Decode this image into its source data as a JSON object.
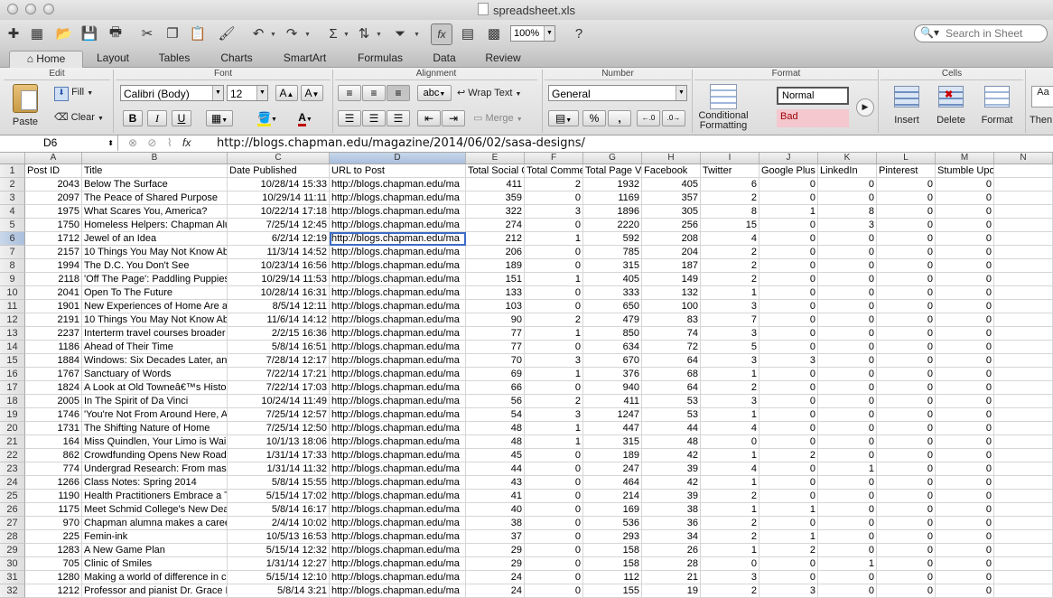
{
  "window": {
    "title": "spreadsheet.xls"
  },
  "toolbar": {
    "zoom": "100%",
    "search_placeholder": "Search in Sheet"
  },
  "ribbon_tabs": [
    {
      "label": "Home"
    },
    {
      "label": "Layout"
    },
    {
      "label": "Tables"
    },
    {
      "label": "Charts"
    },
    {
      "label": "SmartArt"
    },
    {
      "label": "Formulas"
    },
    {
      "label": "Data"
    },
    {
      "label": "Review"
    }
  ],
  "ribbon": {
    "edit_title": "Edit",
    "font_title": "Font",
    "alignment_title": "Alignment",
    "number_title": "Number",
    "format_title": "Format",
    "cells_title": "Cells",
    "paste": "Paste",
    "fill": "Fill",
    "clear": "Clear",
    "font_name": "Calibri (Body)",
    "font_size": "12",
    "bold": "B",
    "italic": "I",
    "underline": "U",
    "wrap_text": "Wrap Text",
    "merge": "Merge",
    "abc": "abc",
    "number_format": "General",
    "percent": "%",
    "comma": ",",
    "conditional_formatting_1": "Conditional",
    "conditional_formatting_2": "Formatting",
    "style_normal": "Normal",
    "style_bad": "Bad",
    "insert": "Insert",
    "delete": "Delete",
    "format": "Format",
    "themes": "Then"
  },
  "formula_bar": {
    "cell_ref": "D6",
    "fx": "fx",
    "content": "http://blogs.chapman.edu/magazine/2014/06/02/sasa-designs/"
  },
  "sheet": {
    "columns": [
      "A",
      "B",
      "C",
      "D",
      "E",
      "F",
      "G",
      "H",
      "I",
      "J",
      "K",
      "L",
      "M",
      "N"
    ],
    "headers": [
      "Post ID",
      "Title",
      "Date Published",
      "URL to Post",
      "Total Social C",
      "Total Comme",
      "Total Page Vi",
      "Facebook",
      "Twitter",
      "Google Plus",
      "LinkedIn",
      "Pinterest",
      "Stumble Upon",
      ""
    ],
    "row_numbers": [
      "1",
      "2",
      "3",
      "4",
      "5",
      "6",
      "7",
      "8",
      "9",
      "10",
      "11",
      "12",
      "13",
      "14",
      "15",
      "16",
      "17",
      "18",
      "19",
      "20",
      "21",
      "22",
      "23",
      "24",
      "25",
      "26",
      "27",
      "28",
      "29",
      "30",
      "31",
      "32"
    ],
    "rows": [
      [
        "2043",
        "Below The Surface",
        "10/28/14 15:33",
        "http://blogs.chapman.edu/ma",
        "411",
        "2",
        "1932",
        "405",
        "6",
        "0",
        "0",
        "0",
        "0"
      ],
      [
        "2097",
        "The Peace of Shared Purpose",
        "10/29/14 11:11",
        "http://blogs.chapman.edu/ma",
        "359",
        "0",
        "1169",
        "357",
        "2",
        "0",
        "0",
        "0",
        "0"
      ],
      [
        "1975",
        "What Scares You, America?",
        "10/22/14 17:18",
        "http://blogs.chapman.edu/ma",
        "322",
        "3",
        "1896",
        "305",
        "8",
        "1",
        "8",
        "0",
        "0"
      ],
      [
        "1750",
        "Homeless Helpers: Chapman Alu",
        "7/25/14 12:45",
        "http://blogs.chapman.edu/ma",
        "274",
        "0",
        "2220",
        "256",
        "15",
        "0",
        "3",
        "0",
        "0"
      ],
      [
        "1712",
        "Jewel of an Idea",
        "6/2/14 12:19",
        "http://blogs.chapman.edu/ma",
        "212",
        "1",
        "592",
        "208",
        "4",
        "0",
        "0",
        "0",
        "0"
      ],
      [
        "2157",
        "10 Things You May Not Know Ab",
        "11/3/14 14:52",
        "http://blogs.chapman.edu/ma",
        "206",
        "0",
        "785",
        "204",
        "2",
        "0",
        "0",
        "0",
        "0"
      ],
      [
        "1994",
        "The D.C. You Don't See",
        "10/23/14 16:56",
        "http://blogs.chapman.edu/ma",
        "189",
        "0",
        "315",
        "187",
        "2",
        "0",
        "0",
        "0",
        "0"
      ],
      [
        "2118",
        "'Off The Page': Paddling Puppies",
        "10/29/14 11:53",
        "http://blogs.chapman.edu/ma",
        "151",
        "1",
        "405",
        "149",
        "2",
        "0",
        "0",
        "0",
        "0"
      ],
      [
        "2041",
        "Open To The Future",
        "10/28/14 16:31",
        "http://blogs.chapman.edu/ma",
        "133",
        "0",
        "333",
        "132",
        "1",
        "0",
        "0",
        "0",
        "0"
      ],
      [
        "1901",
        "New Experiences of Home Are a",
        "8/5/14 12:11",
        "http://blogs.chapman.edu/ma",
        "103",
        "0",
        "650",
        "100",
        "3",
        "0",
        "0",
        "0",
        "0"
      ],
      [
        "2191",
        "10 Things You May Not Know Ab",
        "11/6/14 14:12",
        "http://blogs.chapman.edu/ma",
        "90",
        "2",
        "479",
        "83",
        "7",
        "0",
        "0",
        "0",
        "0"
      ],
      [
        "2237",
        "Interterm travel courses broader",
        "2/2/15 16:36",
        "http://blogs.chapman.edu/ma",
        "77",
        "1",
        "850",
        "74",
        "3",
        "0",
        "0",
        "0",
        "0"
      ],
      [
        "1186",
        "Ahead of Their Time",
        "5/8/14 16:51",
        "http://blogs.chapman.edu/ma",
        "77",
        "0",
        "634",
        "72",
        "5",
        "0",
        "0",
        "0",
        "0"
      ],
      [
        "1884",
        "Windows: Six Decades Later, an",
        "7/28/14 12:17",
        "http://blogs.chapman.edu/ma",
        "70",
        "3",
        "670",
        "64",
        "3",
        "3",
        "0",
        "0",
        "0"
      ],
      [
        "1767",
        "Sanctuary of Words",
        "7/22/14 17:21",
        "http://blogs.chapman.edu/ma",
        "69",
        "1",
        "376",
        "68",
        "1",
        "0",
        "0",
        "0",
        "0"
      ],
      [
        "1824",
        "A Look at Old Towneâ€™s Histor",
        "7/22/14 17:03",
        "http://blogs.chapman.edu/ma",
        "66",
        "0",
        "940",
        "64",
        "2",
        "0",
        "0",
        "0",
        "0"
      ],
      [
        "2005",
        "In The Spirit of Da Vinci",
        "10/24/14 11:49",
        "http://blogs.chapman.edu/ma",
        "56",
        "2",
        "411",
        "53",
        "3",
        "0",
        "0",
        "0",
        "0"
      ],
      [
        "1746",
        "'You're Not From Around Here, A",
        "7/25/14 12:57",
        "http://blogs.chapman.edu/ma",
        "54",
        "3",
        "1247",
        "53",
        "1",
        "0",
        "0",
        "0",
        "0"
      ],
      [
        "1731",
        "The Shifting Nature of Home",
        "7/25/14 12:50",
        "http://blogs.chapman.edu/ma",
        "48",
        "1",
        "447",
        "44",
        "4",
        "0",
        "0",
        "0",
        "0"
      ],
      [
        "164",
        "Miss Quindlen, Your Limo is Wai",
        "10/1/13 18:06",
        "http://blogs.chapman.edu/ma",
        "48",
        "1",
        "315",
        "48",
        "0",
        "0",
        "0",
        "0",
        "0"
      ],
      [
        "862",
        "Crowdfunding Opens New Roads",
        "1/31/14 17:33",
        "http://blogs.chapman.edu/ma",
        "45",
        "0",
        "189",
        "42",
        "1",
        "2",
        "0",
        "0",
        "0"
      ],
      [
        "774",
        "Undergrad Research: From mass",
        "1/31/14 11:32",
        "http://blogs.chapman.edu/ma",
        "44",
        "0",
        "247",
        "39",
        "4",
        "0",
        "1",
        "0",
        "0"
      ],
      [
        "1266",
        "Class Notes: Spring 2014",
        "5/8/14 15:55",
        "http://blogs.chapman.edu/ma",
        "43",
        "0",
        "464",
        "42",
        "1",
        "0",
        "0",
        "0",
        "0"
      ],
      [
        "1190",
        "Health Practitioners Embrace a T",
        "5/15/14 17:02",
        "http://blogs.chapman.edu/ma",
        "41",
        "0",
        "214",
        "39",
        "2",
        "0",
        "0",
        "0",
        "0"
      ],
      [
        "1175",
        "Meet Schmid College's New Dea",
        "5/8/14 16:17",
        "http://blogs.chapman.edu/ma",
        "40",
        "0",
        "169",
        "38",
        "1",
        "1",
        "0",
        "0",
        "0"
      ],
      [
        "970",
        "Chapman alumna makes a caree",
        "2/4/14 10:02",
        "http://blogs.chapman.edu/ma",
        "38",
        "0",
        "536",
        "36",
        "2",
        "0",
        "0",
        "0",
        "0"
      ],
      [
        "225",
        "Femin-ink",
        "10/5/13 16:53",
        "http://blogs.chapman.edu/ma",
        "37",
        "0",
        "293",
        "34",
        "2",
        "1",
        "0",
        "0",
        "0"
      ],
      [
        "1283",
        "A New Game Plan",
        "5/15/14 12:32",
        "http://blogs.chapman.edu/ma",
        "29",
        "0",
        "158",
        "26",
        "1",
        "2",
        "0",
        "0",
        "0"
      ],
      [
        "705",
        "Clinic of Smiles",
        "1/31/14 12:27",
        "http://blogs.chapman.edu/ma",
        "29",
        "0",
        "158",
        "28",
        "0",
        "0",
        "1",
        "0",
        "0"
      ],
      [
        "1280",
        "Making a world of difference in c",
        "5/15/14 12:10",
        "http://blogs.chapman.edu/ma",
        "24",
        "0",
        "112",
        "21",
        "3",
        "0",
        "0",
        "0",
        "0"
      ],
      [
        "1212",
        "Professor and pianist Dr. Grace F",
        "5/8/14 3:21",
        "http://blogs.chapman.edu/ma",
        "24",
        "0",
        "155",
        "19",
        "2",
        "3",
        "0",
        "0",
        "0"
      ]
    ]
  }
}
